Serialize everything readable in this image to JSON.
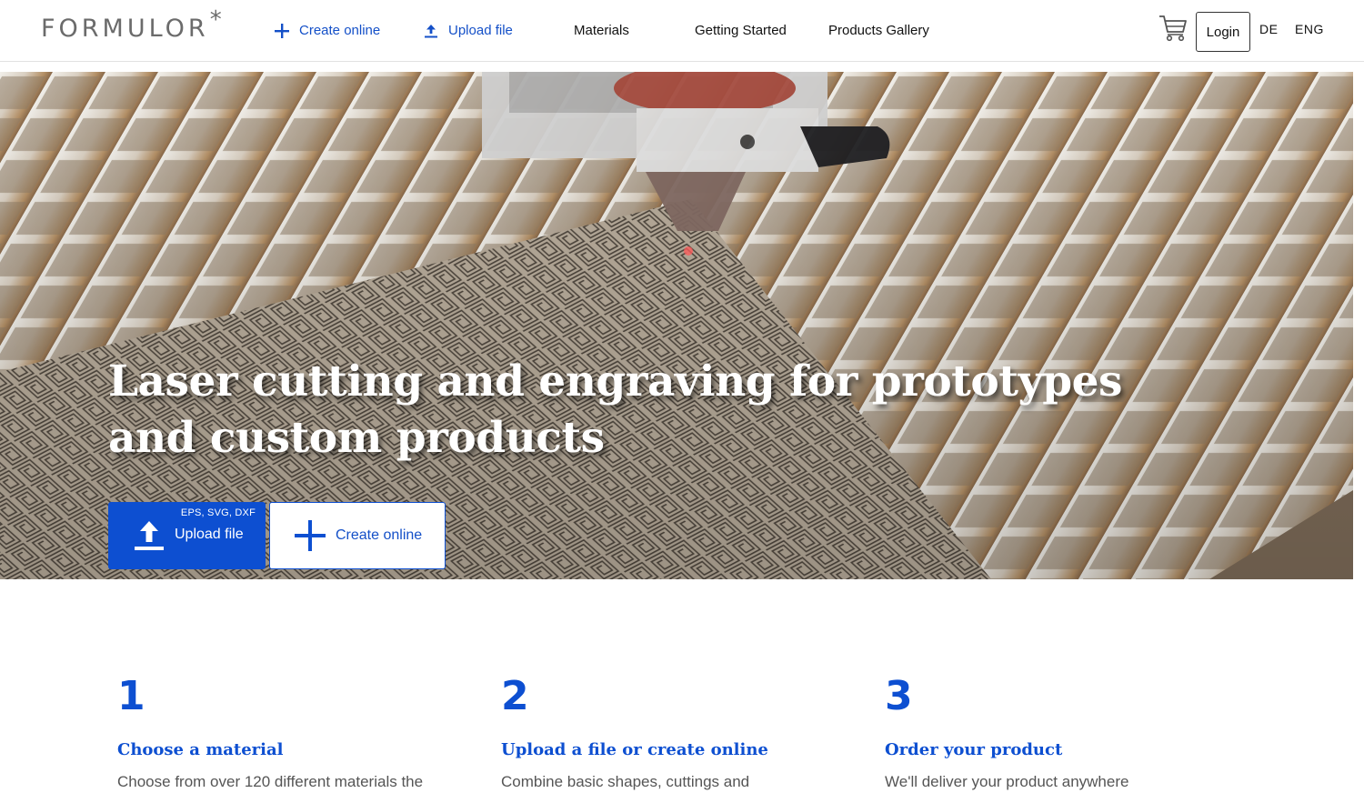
{
  "header": {
    "logo_text": "FORMULOR",
    "logo_mark": "*",
    "nav": {
      "create_online": "Create online",
      "upload_file": "Upload file",
      "materials": "Materials",
      "getting_started": "Getting Started",
      "products_gallery": "Products Gallery"
    },
    "login": "Login",
    "lang_de": "DE",
    "lang_eng": "ENG"
  },
  "hero": {
    "title_line1": "Laser cutting and engraving for prototypes",
    "title_line2": "and custom products",
    "upload_button": "Upload file",
    "upload_formats": "EPS, SVG, DXF",
    "create_button": "Create online"
  },
  "steps": [
    {
      "number": "1",
      "title": "Choose a material",
      "desc": "Choose from over 120 different materials the"
    },
    {
      "number": "2",
      "title": "Upload a file or create online",
      "desc": "Combine basic shapes, cuttings and"
    },
    {
      "number": "3",
      "title": "Order your product",
      "desc": "We'll deliver your product anywhere"
    }
  ],
  "colors": {
    "accent": "#0d4fd1",
    "nav_link": "#1450c8"
  },
  "icons": {
    "plus": "plus-icon",
    "upload": "upload-icon",
    "cart": "cart-icon"
  }
}
